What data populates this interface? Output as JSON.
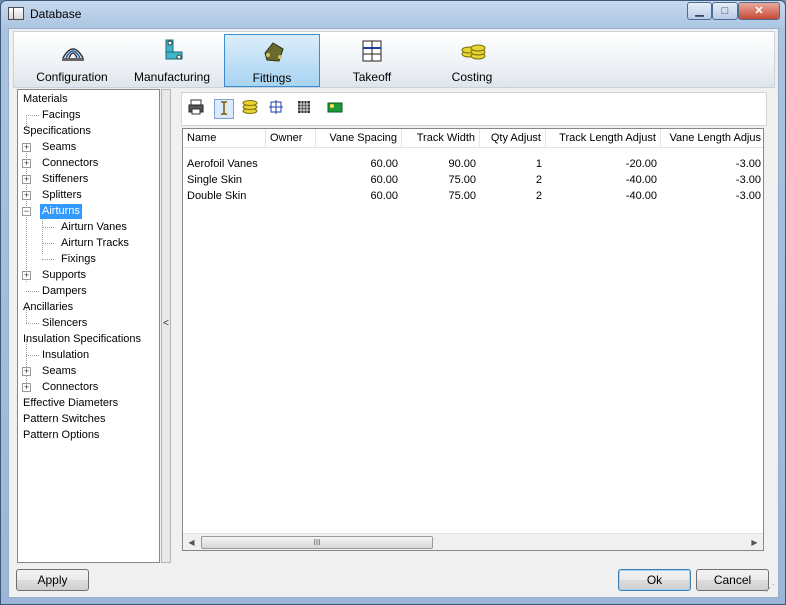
{
  "window": {
    "title": "Database",
    "min_glyph": "▁",
    "max_glyph": "□",
    "close_glyph": "✕"
  },
  "ribbon": {
    "tabs": [
      {
        "label": "Configuration",
        "icon": "configuration-icon"
      },
      {
        "label": "Manufacturing",
        "icon": "manufacturing-icon"
      },
      {
        "label": "Fittings",
        "icon": "fittings-icon",
        "active": true
      },
      {
        "label": "Takeoff",
        "icon": "takeoff-icon"
      },
      {
        "label": "Costing",
        "icon": "costing-icon"
      }
    ]
  },
  "tree": {
    "nodes": [
      "Materials",
      "Facings",
      "Specifications",
      "Seams",
      "Connectors",
      "Stiffeners",
      "Splitters",
      "Airturns",
      "Airturn Vanes",
      "Airturn Tracks",
      "Fixings",
      "Supports",
      "Dampers",
      "Ancillaries",
      "Silencers",
      "Insulation Specifications",
      "Insulation",
      "Seams",
      "Connectors",
      "Effective Diameters",
      "Pattern Switches",
      "Pattern Options"
    ],
    "selected": "Airturns",
    "expand_glyph": "+",
    "collapse_glyph": "−"
  },
  "splitter": {
    "glyph": "<"
  },
  "toolbar": {
    "icons": [
      "print-icon",
      "text-cursor-icon",
      "coins-icon",
      "crosshair-icon",
      "grid-icon",
      "green-card-icon"
    ]
  },
  "grid": {
    "columns": [
      "Name",
      "Owner",
      "Vane Spacing",
      "Track Width",
      "Qty Adjust",
      "Track Length Adjust",
      "Vane Length Adjus"
    ],
    "rows": [
      [
        "Aerofoil Vanes",
        "",
        "60.00",
        "90.00",
        "1",
        "-20.00",
        "-3.00"
      ],
      [
        "Single Skin",
        "",
        "60.00",
        "75.00",
        "2",
        "-40.00",
        "-3.00"
      ],
      [
        "Double Skin",
        "",
        "60.00",
        "75.00",
        "2",
        "-40.00",
        "-3.00"
      ]
    ],
    "scroll_left_glyph": "◀",
    "scroll_right_glyph": "▶",
    "thumb_glyph": "III"
  },
  "buttons": {
    "apply": "Apply",
    "ok": "Ok",
    "cancel": "Cancel"
  },
  "grip_glyph": "⋰",
  "colors": {
    "selection": "#3399ff",
    "accent": "#3c8ed3"
  }
}
